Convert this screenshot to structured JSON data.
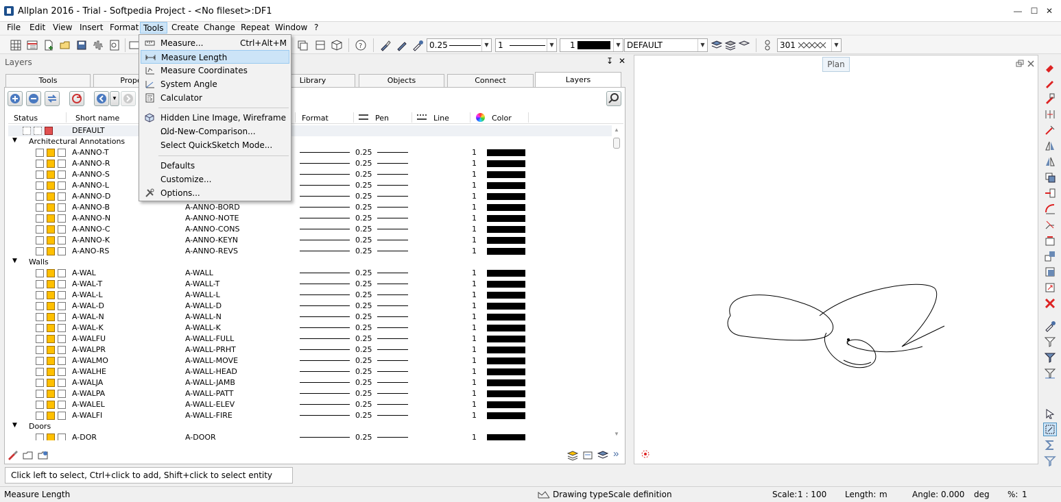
{
  "window": {
    "title": "Allplan 2016 - Trial - Softpedia Project - <No fileset>:DF1",
    "min_label": "—",
    "max_label": "☐",
    "close_label": "✕"
  },
  "menubar": [
    {
      "label": "File"
    },
    {
      "label": "Edit"
    },
    {
      "label": "View"
    },
    {
      "label": "Insert"
    },
    {
      "label": "Format"
    },
    {
      "label": "Tools"
    },
    {
      "label": "Create"
    },
    {
      "label": "Change"
    },
    {
      "label": "Repeat"
    },
    {
      "label": "Window"
    },
    {
      "label": "?"
    }
  ],
  "tools_menu": [
    {
      "label": "Measure...",
      "shortcut": "Ctrl+Alt+M",
      "icon": "ruler-icon"
    },
    {
      "label": "Measure Length",
      "shortcut": "",
      "icon": "measure-length-icon"
    },
    {
      "label": "Measure Coordinates",
      "shortcut": "",
      "icon": "coordinates-icon"
    },
    {
      "label": "System Angle",
      "shortcut": "",
      "icon": "angle-icon"
    },
    {
      "label": "Calculator",
      "shortcut": "",
      "icon": "calculator-icon"
    },
    {
      "label": "Hidden Line Image, Wireframe ...",
      "shortcut": "",
      "icon": "cube-icon"
    },
    {
      "label": "Old-New-Comparison...",
      "shortcut": "",
      "icon": ""
    },
    {
      "label": "Select QuickSketch Mode...",
      "shortcut": "",
      "icon": ""
    },
    {
      "label": "Defaults",
      "shortcut": "",
      "icon": ""
    },
    {
      "label": "Customize...",
      "shortcut": "",
      "icon": ""
    },
    {
      "label": "Options...",
      "shortcut": "",
      "icon": "tools-icon"
    }
  ],
  "toolbar": {
    "pen_value": "0.25",
    "line_value": "1",
    "color_value": "1",
    "layer_value": "DEFAULT",
    "pattern_value": "301"
  },
  "layers_panel": {
    "title": "Layers",
    "pin_label": "↧",
    "close_label": "✕",
    "tabs": [
      "Tools",
      "Prope",
      "Library",
      "Objects",
      "Connect",
      "Layers"
    ],
    "columns": [
      "Status",
      "Short name",
      "Format",
      "Pen",
      "Line",
      "Color"
    ],
    "default_row": "DEFAULT",
    "groups": [
      {
        "name": "Architectural Annotations",
        "rows": [
          {
            "short": "A-ANNO-T",
            "full": ""
          },
          {
            "short": "A-ANNO-R",
            "full": ""
          },
          {
            "short": "A-ANNO-S",
            "full": ""
          },
          {
            "short": "A-ANNO-L",
            "full": ""
          },
          {
            "short": "A-ANNO-D",
            "full": ""
          },
          {
            "short": "A-ANNO-B",
            "full": "A-ANNO-BORD"
          },
          {
            "short": "A-ANNO-N",
            "full": "A-ANNO-NOTE"
          },
          {
            "short": "A-ANNO-C",
            "full": "A-ANNO-CONS"
          },
          {
            "short": "A-ANNO-K",
            "full": "A-ANNO-KEYN"
          },
          {
            "short": "A-ANO-RS",
            "full": "A-ANNO-REVS"
          }
        ]
      },
      {
        "name": "Walls",
        "rows": [
          {
            "short": "A-WAL",
            "full": "A-WALL"
          },
          {
            "short": "A-WAL-T",
            "full": "A-WALL-T"
          },
          {
            "short": "A-WAL-L",
            "full": "A-WALL-L"
          },
          {
            "short": "A-WAL-D",
            "full": "A-WALL-D"
          },
          {
            "short": "A-WAL-N",
            "full": "A-WALL-N"
          },
          {
            "short": "A-WAL-K",
            "full": "A-WALL-K"
          },
          {
            "short": "A-WALFU",
            "full": "A-WALL-FULL"
          },
          {
            "short": "A-WALPR",
            "full": "A-WALL-PRHT"
          },
          {
            "short": "A-WALMO",
            "full": "A-WALL-MOVE"
          },
          {
            "short": "A-WALHE",
            "full": "A-WALL-HEAD"
          },
          {
            "short": "A-WALJA",
            "full": "A-WALL-JAMB"
          },
          {
            "short": "A-WALPA",
            "full": "A-WALL-PATT"
          },
          {
            "short": "A-WALEL",
            "full": "A-WALL-ELEV"
          },
          {
            "short": "A-WALFI",
            "full": "A-WALL-FIRE"
          }
        ]
      },
      {
        "name": "Doors",
        "rows": [
          {
            "short": "A-DOR",
            "full": "A-DOOR"
          }
        ]
      }
    ],
    "row_pen": "0.25",
    "row_line": "1"
  },
  "plan": {
    "tag": "Plan"
  },
  "prompt": "Click left to select, Ctrl+click to add, Shift+click to select entity group",
  "statusbar": {
    "command": "Measure Length",
    "drawing_type_label": "Drawing type:",
    "drawing_type_value": "Scale definition",
    "scale_label": "Scale:",
    "scale_value": "1 : 100",
    "length_label": "Length:",
    "length_value": "m",
    "angle_label": "Angle:",
    "angle_value": "0.000",
    "angle_unit": "deg",
    "percent_label": "%:",
    "percent_value": "1"
  }
}
